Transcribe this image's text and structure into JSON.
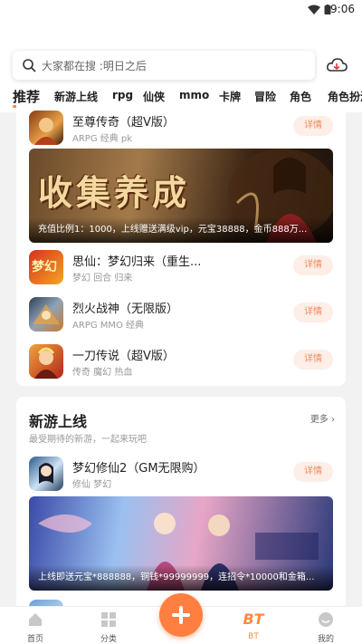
{
  "status": {
    "time": "9:06"
  },
  "search": {
    "placeholder": "大家都在搜 :明日之后"
  },
  "tabs": [
    "推荐",
    "新游上线",
    "rpg",
    "仙侠",
    "mmo",
    "卡牌",
    "冒险",
    "角色",
    "角色扮演"
  ],
  "featured": {
    "games": [
      {
        "name": "至尊传奇（超V版）",
        "tags": "ARPG 经典 pk",
        "button": "详情"
      },
      {
        "name": " 思仙：梦幻归来（重生...",
        "tags": "梦幻 回合 归来",
        "button": "详情"
      },
      {
        "name": "烈火战神（无限版）",
        "tags": "ARPG MMO 经典",
        "button": "详情"
      },
      {
        "name": "一刀传说（超V版）",
        "tags": "传奇 魔幻 热血",
        "button": "详情"
      }
    ],
    "banner": {
      "art_text": "收集养成",
      "caption": "充值比例1：1000，上线赠送满级vip，元宝38888，金币888万..."
    },
    "icon_text": "梦幻"
  },
  "new_games": {
    "title": "新游上线",
    "subtitle": "最受期待的新游，一起来玩吧",
    "more": "更多",
    "games": [
      {
        "name": "梦幻修仙2（GM无限购）",
        "tags": "修仙 梦幻",
        "button": "详情"
      }
    ],
    "banner": {
      "caption": "上线即送元宝*888888，铜钱*99999999，连招令*10000和金箱..."
    },
    "partial_game": " ..."
  },
  "bottom_nav": [
    {
      "label": "首页"
    },
    {
      "label": "分类"
    },
    {
      "label": "BT",
      "icon_text": "BT"
    },
    {
      "label": "我的"
    }
  ],
  "colors": {
    "accent": "#ff8a3d",
    "button_bg": "#fdeee7",
    "button_text": "#f08a5d"
  }
}
